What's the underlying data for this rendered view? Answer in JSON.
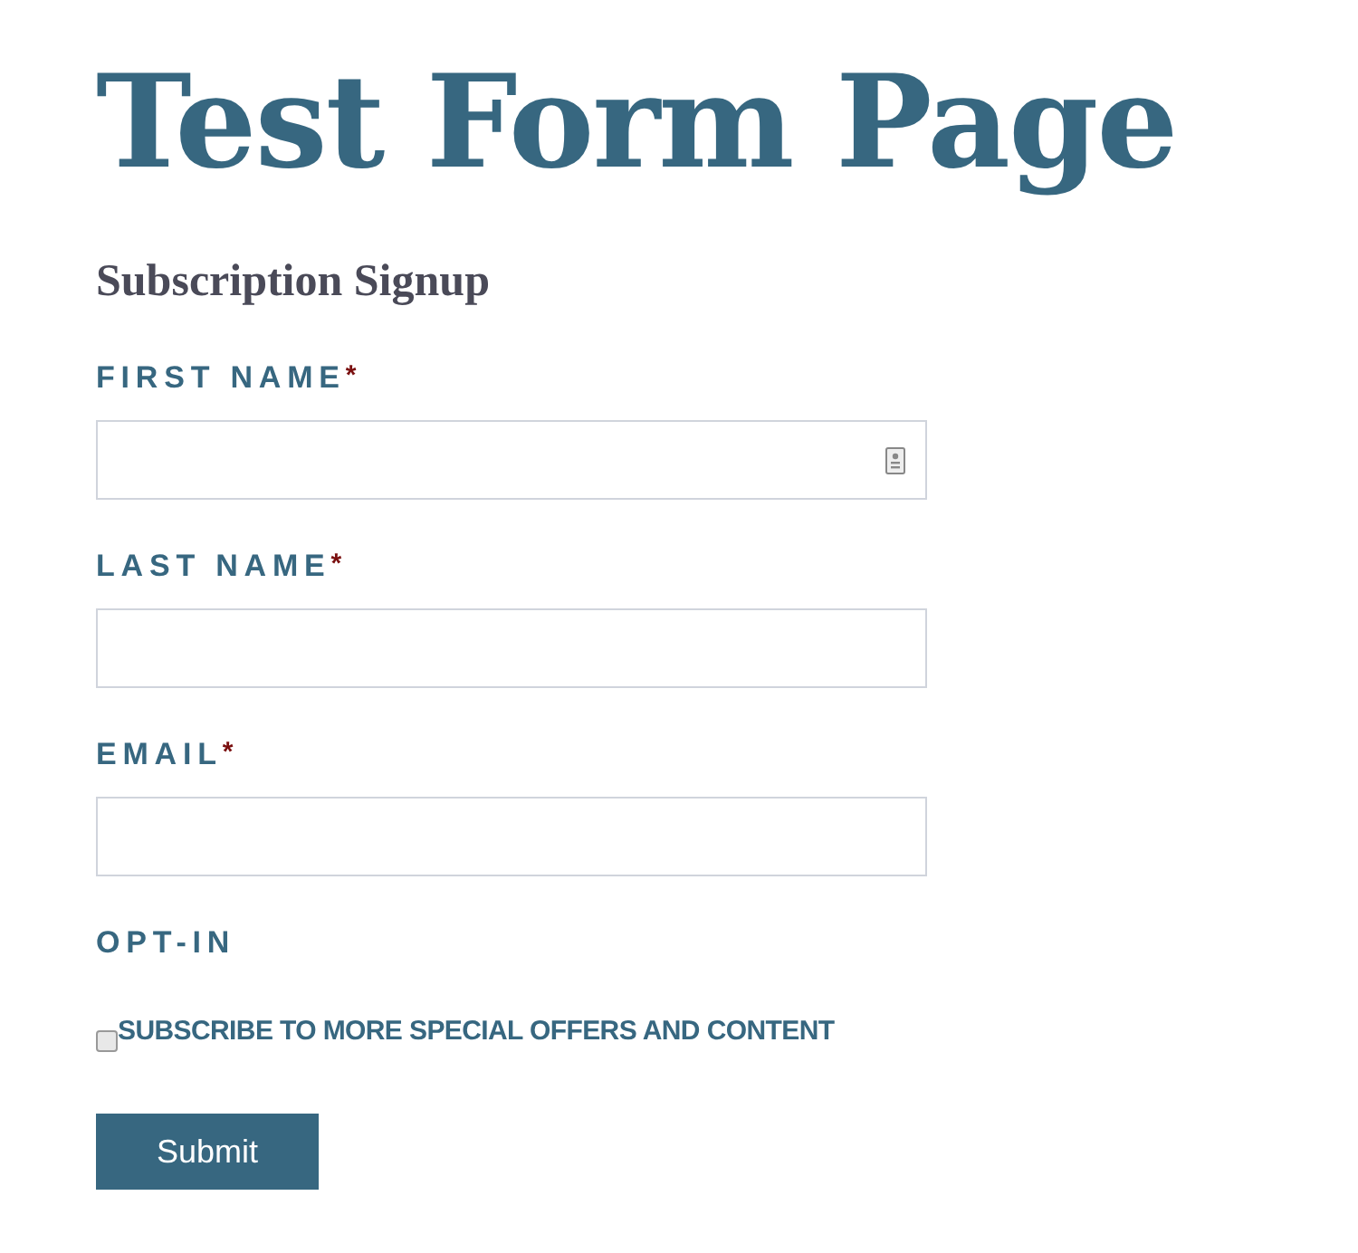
{
  "title": "Test Form Page",
  "subtitle": "Subscription Signup",
  "fields": [
    {
      "label": "FIRST NAME",
      "required_mark": "*",
      "autofill_icon": true
    },
    {
      "label": "LAST NAME",
      "required_mark": "*",
      "autofill_icon": false
    },
    {
      "label": "EMAIL",
      "required_mark": "*",
      "autofill_icon": false
    }
  ],
  "opt_in": {
    "label": "OPT-IN",
    "checkbox_label": "SUBSCRIBE TO MORE SPECIAL OFFERS AND CONTENT",
    "checked": false
  },
  "submit": "Submit"
}
